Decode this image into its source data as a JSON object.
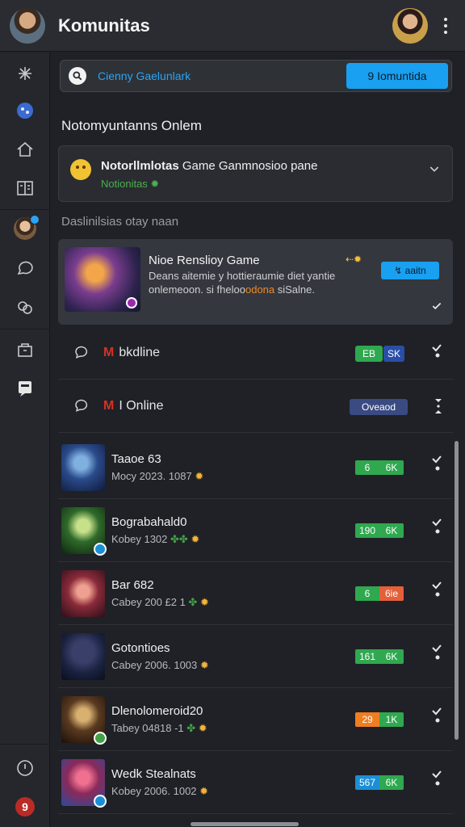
{
  "header": {
    "title": "Komunitas"
  },
  "sidebar": {
    "items": [
      "compass-icon",
      "discover-icon",
      "home-icon",
      "book-icon",
      "profile-avatar",
      "chat-icon",
      "groups-icon",
      "store-icon",
      "message-icon",
      "info-icon"
    ],
    "badge": "9"
  },
  "search": {
    "placeholder": "Cienny Gaelunlark",
    "button_label": "9 Iomuntida"
  },
  "section": {
    "title": "Notomyuntanns Onlem"
  },
  "status_card": {
    "title_bold": "Notorllmlotas",
    "title_rest": " Game Ganmnosioo pane",
    "subtitle": "Notionitas ✹"
  },
  "subsection": {
    "title": "Daslinilsias otay naan"
  },
  "featured": {
    "title": "Nioe Renslioy Game",
    "arrow_text": "⇠✹",
    "desc_line1": "Deans aitemie y hottieraumie diet yantie",
    "desc_line2_plain": "onlemeoon. si fheloo",
    "desc_line2_accent": "odona",
    "desc_line2_tail": " siSalne.",
    "button_label": "↯ aaitn"
  },
  "online_rows": [
    {
      "m": "M",
      "label": "bkdline",
      "pill_a": "ЕВ",
      "pill_b": "SK"
    },
    {
      "m": "M",
      "label": "I Online",
      "pill": "Oveaod"
    }
  ],
  "games": [
    {
      "title": "Taaoe 63",
      "meta": "Mocy 2023. 1087",
      "leaf": "",
      "star": "✹",
      "pill_a": "6",
      "pill_b": "6K",
      "pill_color": "#2fa84f",
      "pill_b_color": "#2fa84f"
    },
    {
      "title": "Bograbahald0",
      "meta": "Kobey 1302 ",
      "leaf": "✤✤",
      "star": "✹",
      "pill_a": "190",
      "pill_b": "6K",
      "pill_color": "#2fa84f",
      "pill_b_color": "#2fa84f"
    },
    {
      "title": "Bar 682",
      "meta": "Cabey 200 £2 1 ",
      "leaf": "✤",
      "star": "✹",
      "pill_a": "6",
      "pill_b": "6ie",
      "pill_color": "#2fa84f",
      "pill_b_color": "#e5603a"
    },
    {
      "title": "Gotontioes",
      "meta": "Cabey 2006. 1003",
      "leaf": "",
      "star": "✹",
      "pill_a": "161",
      "pill_b": "6K",
      "pill_color": "#2fa84f",
      "pill_b_color": "#2fa84f"
    },
    {
      "title": "Dlenolomeroid20",
      "meta": "Tabey 04818 -1 ",
      "leaf": "✤",
      "star": "✹",
      "pill_a": "29",
      "pill_b": "1K",
      "pill_color": "#ef7e20",
      "pill_b_color": "#2fa84f"
    },
    {
      "title": "Wedk Stealnats",
      "meta": "Kobey 2006. 1002",
      "leaf": "",
      "star": "✹",
      "pill_a": "567",
      "pill_b": "6K",
      "pill_color": "#1a8fd6",
      "pill_b_color": "#2fa84f"
    }
  ],
  "colors": {
    "accent": "#19a0f0",
    "background": "#1f2126",
    "panel": "#2a2c31"
  }
}
